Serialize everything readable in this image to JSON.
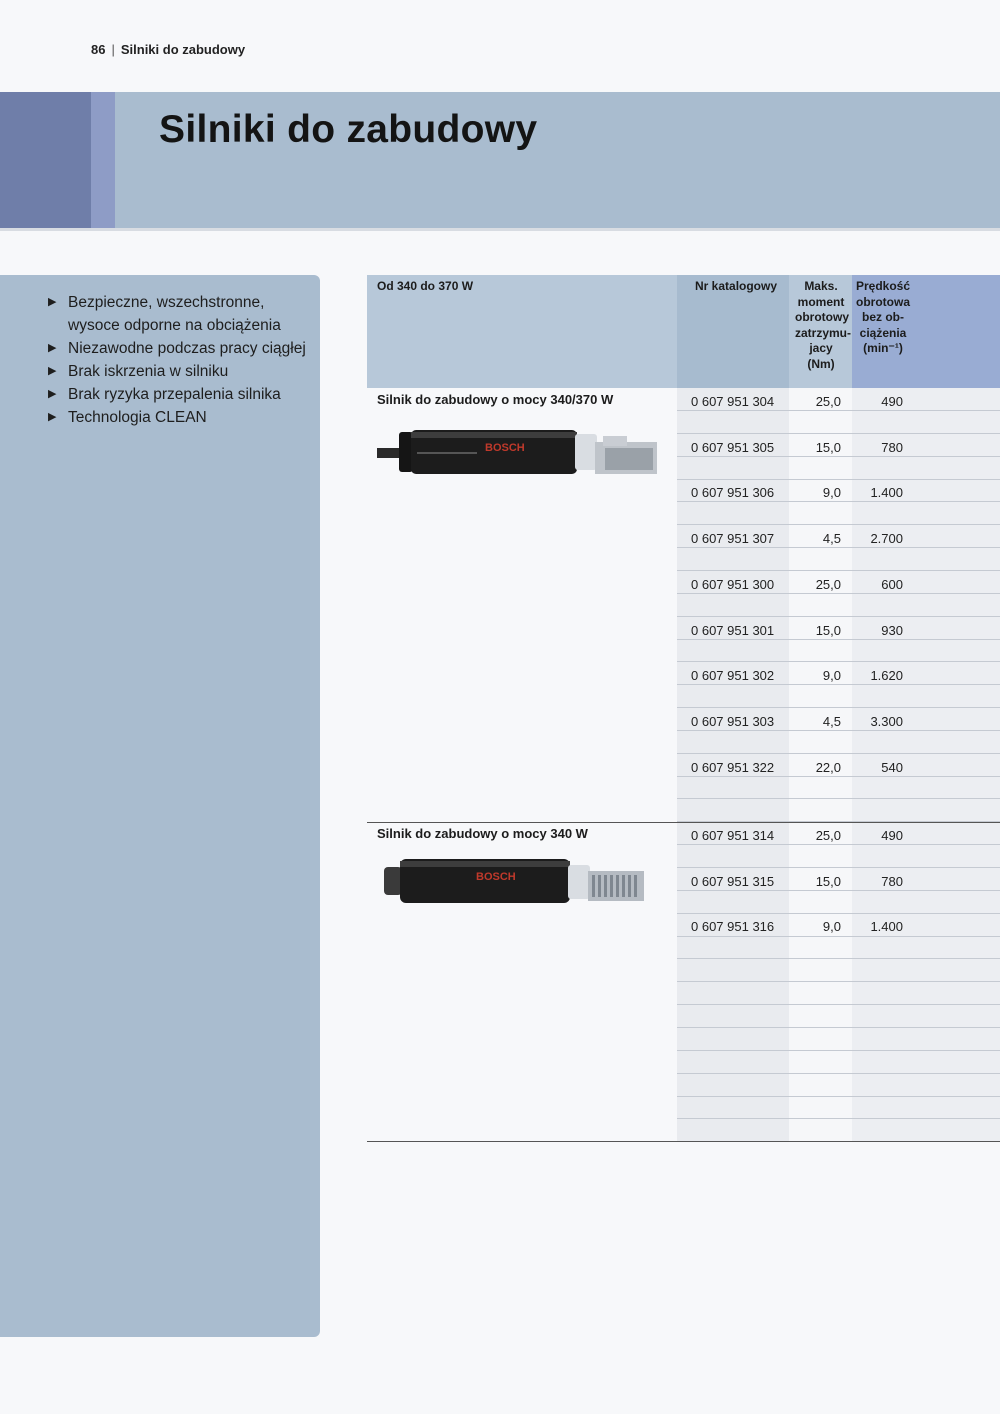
{
  "running_head": {
    "page": "86",
    "section": "Silniki do zabudowy"
  },
  "banner": {
    "title": "Silniki do zabudowy"
  },
  "features": [
    "Bezpieczne, wszechstronne, wysoce odporne na obciążenia",
    "Niezawodne podczas pracy ciągłej",
    "Brak iskrzenia w silniku",
    "Brak ryzyka przepalenia silnika",
    "Technologia CLEAN"
  ],
  "table": {
    "headers": {
      "product": "Od 340 do 370 W",
      "catalog": "Nr katalogowy",
      "torque": "Maks. moment obrotowy zatrzymu- jacy (Nm)",
      "speed": "Prędkość obrotowa bez ob- ciążenia (min⁻¹)"
    },
    "groups": [
      {
        "title": "Silnik do zabudowy o mocy 340/370 W",
        "brand_on_image": "BOSCH",
        "rows": [
          {
            "catalog": "0 607 951 304",
            "torque": "25,0",
            "speed": "490"
          },
          {
            "catalog": "0 607 951 305",
            "torque": "15,0",
            "speed": "780"
          },
          {
            "catalog": "0 607 951 306",
            "torque": "9,0",
            "speed": "1.400"
          },
          {
            "catalog": "0 607 951 307",
            "torque": "4,5",
            "speed": "2.700"
          },
          {
            "catalog": "0 607 951 300",
            "torque": "25,0",
            "speed": "600"
          },
          {
            "catalog": "0 607 951 301",
            "torque": "15,0",
            "speed": "930"
          },
          {
            "catalog": "0 607 951 302",
            "torque": "9,0",
            "speed": "1.620"
          },
          {
            "catalog": "0 607 951 303",
            "torque": "4,5",
            "speed": "3.300"
          },
          {
            "catalog": "0 607 951 322",
            "torque": "22,0",
            "speed": "540"
          }
        ]
      },
      {
        "title": "Silnik do zabudowy o mocy 340 W",
        "brand_on_image": "BOSCH",
        "rows": [
          {
            "catalog": "0 607 951 314",
            "torque": "25,0",
            "speed": "490"
          },
          {
            "catalog": "0 607 951 315",
            "torque": "15,0",
            "speed": "780"
          },
          {
            "catalog": "0 607 951 316",
            "torque": "9,0",
            "speed": "1.400"
          }
        ]
      }
    ]
  },
  "colors": {
    "banner": "#a9bccf",
    "banner_stripe_dark": "#6f7ea9",
    "banner_stripe_light": "#8e9cc6",
    "sidebar": "#a9bccf",
    "speed_header": "#99acd3",
    "motor_body": "#1c1c1c",
    "brand_text": "#c0392b"
  }
}
